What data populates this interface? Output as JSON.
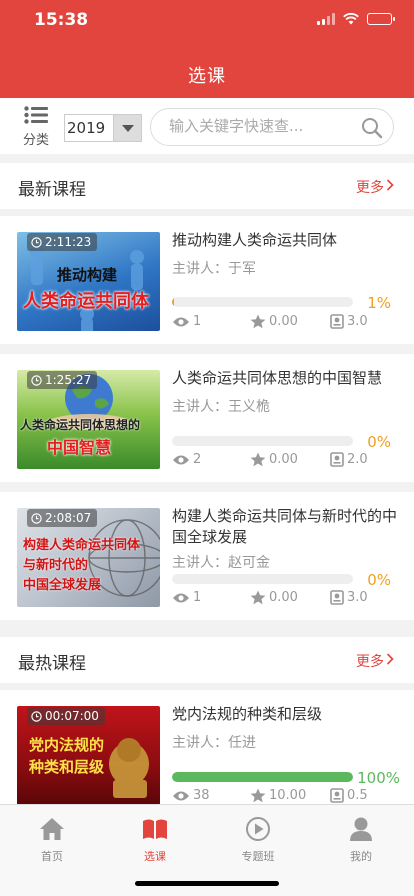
{
  "status": {
    "time": "15:38"
  },
  "header": {
    "title": "选课"
  },
  "filter": {
    "category_label": "分类",
    "year": "2019",
    "search_placeholder": "输入关键字快速查..."
  },
  "sections": {
    "latest": {
      "title": "最新课程",
      "more": "更多"
    },
    "hot": {
      "title": "最热课程",
      "more": "更多"
    }
  },
  "courses": [
    {
      "duration": "2:11:23",
      "thumb_text": [
        "推动构建",
        "人类命运共同体"
      ],
      "title": "推动构建人类命运共同体",
      "lecturer": "主讲人：于军",
      "progress": 0.01,
      "progress_label": "1%",
      "views": "1",
      "rating": "0.00",
      "credits": "3.0"
    },
    {
      "duration": "1:25:27",
      "thumb_text": [
        "人类命运共同体思想的",
        "中国智慧"
      ],
      "title": "人类命运共同体思想的中国智慧",
      "lecturer": "主讲人：王义桅",
      "progress": 0,
      "progress_label": "0%",
      "views": "2",
      "rating": "0.00",
      "credits": "2.0"
    },
    {
      "duration": "2:08:07",
      "thumb_text": [
        "构建人类命运共同体",
        "与新时代的",
        "中国全球发展"
      ],
      "title": "构建人类命运共同体与新时代的中国全球发展",
      "lecturer": "主讲人：赵可金",
      "progress": 0,
      "progress_label": "0%",
      "views": "1",
      "rating": "0.00",
      "credits": "3.0"
    },
    {
      "duration": "00:07:00",
      "thumb_text": [
        "党内法规的",
        "种类和层级"
      ],
      "title": "党内法规的种类和层级",
      "lecturer": "主讲人：任进",
      "progress": 1.0,
      "progress_label": "100%",
      "views": "38",
      "rating": "10.00",
      "credits": "0.5"
    }
  ],
  "tabs": [
    {
      "label": "首页",
      "icon": "home-icon"
    },
    {
      "label": "选课",
      "icon": "book-icon"
    },
    {
      "label": "专题班",
      "icon": "play-icon"
    },
    {
      "label": "我的",
      "icon": "user-icon"
    }
  ],
  "colors": {
    "brand": "#e2453d",
    "progress_orange": "#f0a020",
    "progress_green": "#5cb85c"
  }
}
